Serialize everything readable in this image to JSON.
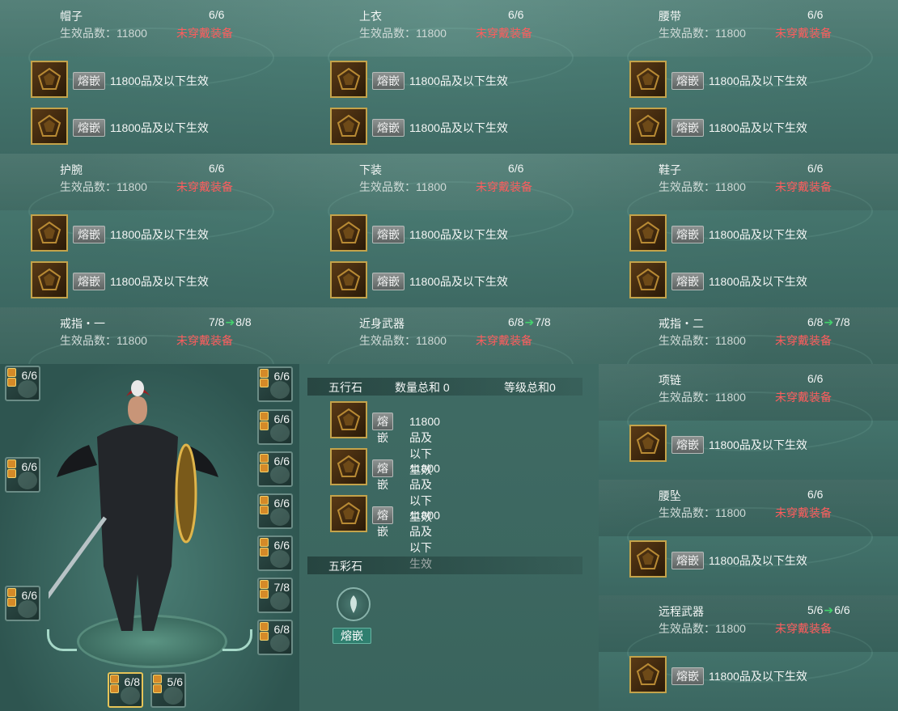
{
  "labels": {
    "effective_prefix": "生效品数：11800",
    "not_worn": "未穿戴装备",
    "inlay": "熔嵌",
    "inlay_desc": "11800品及以下生效"
  },
  "slots": [
    {
      "name": "帽子",
      "count": "6/6",
      "next": ""
    },
    {
      "name": "上衣",
      "count": "6/6",
      "next": ""
    },
    {
      "name": "腰带",
      "count": "6/6",
      "next": ""
    },
    {
      "name": "护腕",
      "count": "6/6",
      "next": ""
    },
    {
      "name": "下装",
      "count": "6/6",
      "next": ""
    },
    {
      "name": "鞋子",
      "count": "6/6",
      "next": ""
    },
    {
      "name": "戒指・一",
      "count": "7/8",
      "next": "8/8"
    },
    {
      "name": "近身武器",
      "count": "6/8",
      "next": "7/8"
    },
    {
      "name": "戒指・二",
      "count": "6/8",
      "next": "7/8"
    },
    {
      "name": "项链",
      "count": "6/6",
      "next": ""
    },
    {
      "name": "腰坠",
      "count": "6/6",
      "next": ""
    },
    {
      "name": "远程武器",
      "count": "5/6",
      "next": "6/6"
    }
  ],
  "character_slots": {
    "left": [
      "6/6",
      "6/6",
      "6/6"
    ],
    "right": [
      "6/6",
      "6/6",
      "6/6",
      "6/6",
      "6/6",
      "7/8",
      "6/8"
    ],
    "bottom": [
      "6/8",
      "5/6"
    ]
  },
  "wuxing": {
    "title": "五行石",
    "count_label": "数量总和",
    "count_value": "0",
    "level_label": "等级总和",
    "level_value": "0"
  },
  "wucai": {
    "title": "五彩石",
    "button": "熔嵌"
  },
  "colors": {
    "warn": "#ff5d5d",
    "arrow": "#43d36d",
    "gold": "#c4a34a",
    "highlight": "#f2d34a"
  }
}
